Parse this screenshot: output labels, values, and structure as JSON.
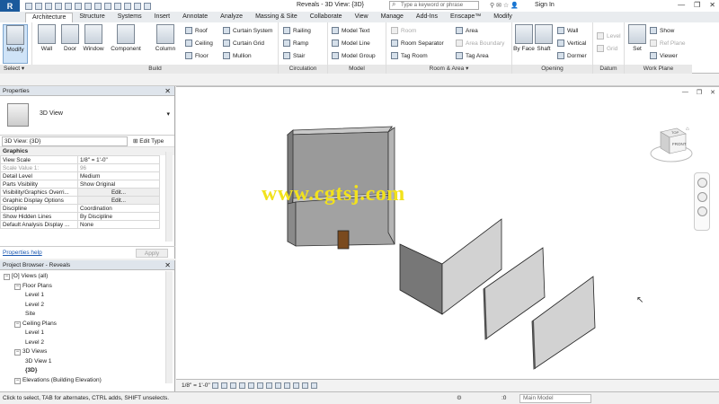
{
  "titlebar": {
    "app_letter": "R",
    "document_title": "Reveals - 3D View: {3D}",
    "search_placeholder": "Type a keyword or phrase",
    "sign_in": "Sign In",
    "window_controls": [
      "—",
      "❐",
      "✕"
    ]
  },
  "ribbon_tabs": [
    "Architecture",
    "Structure",
    "Systems",
    "Insert",
    "Annotate",
    "Analyze",
    "Massing & Site",
    "Collaborate",
    "View",
    "Manage",
    "Add-Ins",
    "Enscape™",
    "Modify"
  ],
  "ribbon": {
    "modify_label": "Modify",
    "select_label": "Select ▾",
    "build": {
      "label": "Build",
      "big": [
        "Wall",
        "Door",
        "Window",
        "Component",
        "Column"
      ],
      "small": [
        "Roof",
        "Ceiling",
        "Floor",
        "Curtain System",
        "Curtain Grid",
        "Mullion"
      ]
    },
    "circulation": {
      "label": "Circulation",
      "small": [
        "Railing",
        "Ramp",
        "Stair"
      ]
    },
    "model": {
      "label": "Model",
      "small": [
        "Model Text",
        "Model Line",
        "Model Group"
      ]
    },
    "room_area": {
      "label": "Room & Area ▾",
      "small": [
        "Room",
        "Room Separator",
        "Tag Room",
        "Area",
        "Area Boundary",
        "Tag Area"
      ]
    },
    "opening": {
      "label": "Opening",
      "big": [
        "By Face",
        "Shaft"
      ],
      "small": [
        "Wall",
        "Vertical",
        "Dormer"
      ]
    },
    "datum": {
      "label": "Datum",
      "small": [
        "Level",
        "Grid"
      ]
    },
    "work_plane": {
      "label": "Work Plane",
      "big": [
        "Set"
      ],
      "small": [
        "Show",
        "Ref Plane",
        "Viewer"
      ]
    }
  },
  "properties": {
    "title": "Properties",
    "type_name": "3D View",
    "instance": "3D View: {3D}",
    "edit_type": "Edit Type",
    "group": "Graphics",
    "rows": [
      {
        "k": "View Scale",
        "v": "1/8\" = 1'-0\""
      },
      {
        "k": "Scale Value    1:",
        "v": "96"
      },
      {
        "k": "Detail Level",
        "v": "Medium"
      },
      {
        "k": "Parts Visibility",
        "v": "Show Original"
      },
      {
        "k": "Visibility/Graphics Overri...",
        "v": "Edit..."
      },
      {
        "k": "Graphic Display Options",
        "v": "Edit..."
      },
      {
        "k": "Discipline",
        "v": "Coordination"
      },
      {
        "k": "Show Hidden Lines",
        "v": "By Discipline"
      },
      {
        "k": "Default Analysis Display ...",
        "v": "None"
      }
    ],
    "help": "Properties help",
    "apply": "Apply"
  },
  "browser": {
    "title": "Project Browser - Reveals",
    "nodes": [
      {
        "t": "[O] Views (all)",
        "lvl": 0,
        "tw": "−"
      },
      {
        "t": "Floor Plans",
        "lvl": 1,
        "tw": "−"
      },
      {
        "t": "Level 1",
        "lvl": 2
      },
      {
        "t": "Level 2",
        "lvl": 2
      },
      {
        "t": "Site",
        "lvl": 2
      },
      {
        "t": "Ceiling Plans",
        "lvl": 1,
        "tw": "−"
      },
      {
        "t": "Level 1",
        "lvl": 2
      },
      {
        "t": "Level 2",
        "lvl": 2
      },
      {
        "t": "3D Views",
        "lvl": 1,
        "tw": "−"
      },
      {
        "t": "3D View 1",
        "lvl": 2
      },
      {
        "t": "{3D}",
        "lvl": 2,
        "bold": true
      },
      {
        "t": "Elevations (Building Elevation)",
        "lvl": 1,
        "tw": "−"
      }
    ]
  },
  "canvas": {
    "watermark": "www.cgtsj.com",
    "viewcube_top": "TOP",
    "viewcube_front": "FRONT"
  },
  "view_bar": {
    "scale": "1/8\" = 1'-0\""
  },
  "status": {
    "hint": "Click to select, TAB for alternates, CTRL adds, SHIFT unselects.",
    "zero": ":0",
    "model": "Main Model"
  },
  "colors": {
    "accent": "#1b5a9c",
    "selection": "#cfe3f7",
    "watermark": "#f2e21c"
  }
}
